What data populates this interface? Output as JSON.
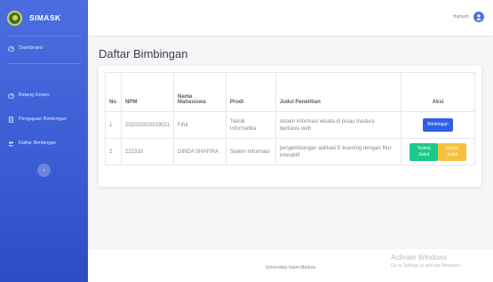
{
  "brand": {
    "name": "SIMASK"
  },
  "sidebar": {
    "items": [
      {
        "label": "Dashboard",
        "icon": "dashboard-icon"
      },
      {
        "label": "Bidang Dosen",
        "icon": "dashboard-icon"
      },
      {
        "label": "Pengajuan Bimbingan",
        "icon": "document-icon"
      },
      {
        "label": "Daftar Bimbingan",
        "icon": "users-icon"
      }
    ],
    "toggle_icon": "chevron-left-icon",
    "toggle_glyph": "‹"
  },
  "topbar": {
    "user_name": "Hairiyah",
    "avatar_icon": "user-avatar-icon"
  },
  "page": {
    "title": "Daftar Bimbingan"
  },
  "table": {
    "headers": {
      "no": "No",
      "npm": "NPM",
      "nama_line1": "Nama",
      "nama_line2": "Mahasiswa",
      "prodi": "Prodi",
      "judul": "Judul Penelitian",
      "aksi": "Aksi"
    },
    "rows": [
      {
        "no": "1",
        "npm": "202020203103021",
        "nama": "Fiful",
        "prodi_line1": "Teknik",
        "prodi_line2": "Informatika",
        "judul_line1": "sistem informasi wisata di pulau madura",
        "judul_line2": "berbasis web",
        "action": "Bimbingan"
      },
      {
        "no": "2",
        "npm": "222333",
        "nama": "DINDA SHAFIRA",
        "prodi_line1": "Sistem Informasi",
        "judul_line1": "pengembangan aplikasi E-learning dengan fitur",
        "judul_line2": "interaktif",
        "accept_line1": "Terima",
        "accept_line2": "Judul",
        "revise_line1": "Revisi",
        "revise_line2": "Judul"
      }
    ]
  },
  "footer": {
    "text": "Universitas Islam Madura"
  },
  "watermark": {
    "title": "Activate Windows",
    "subtitle": "Go to Settings to activate Windows."
  },
  "colors": {
    "sidebar": "#4a6ee0",
    "primary": "#2f5fe8",
    "success": "#1cc88a",
    "warning": "#f6c23e"
  }
}
